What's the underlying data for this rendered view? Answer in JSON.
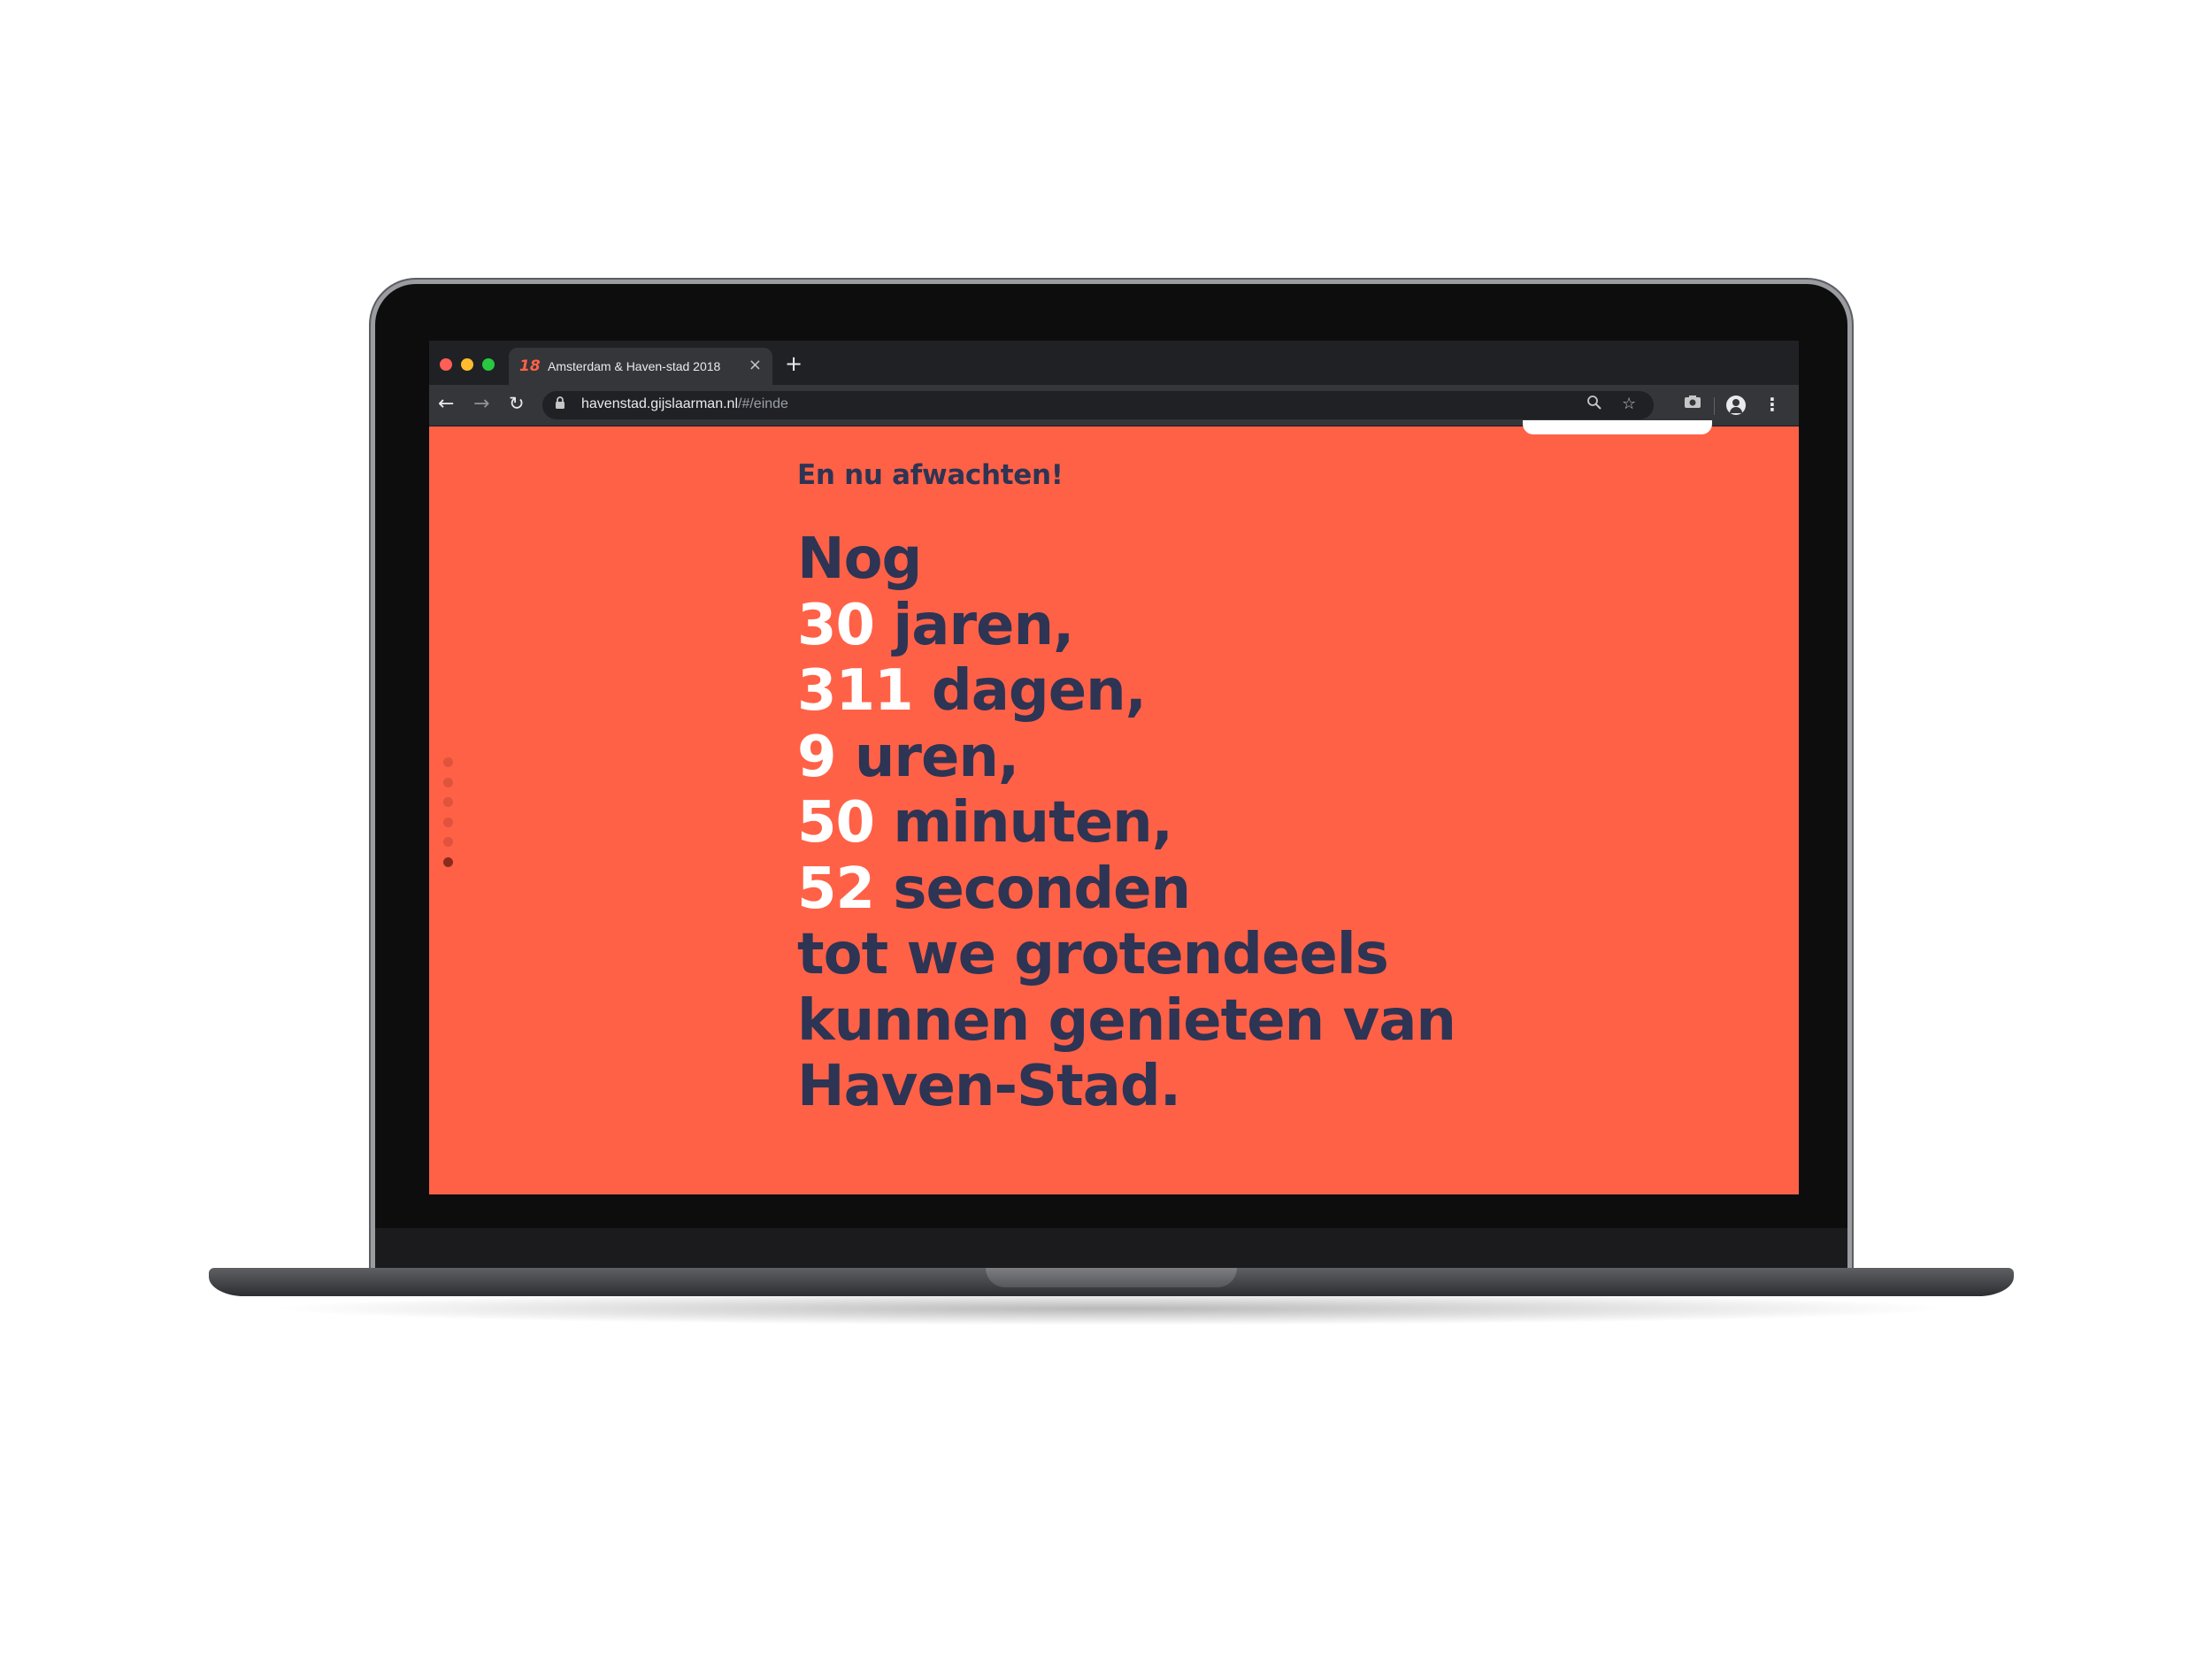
{
  "browser": {
    "tab": {
      "favicon": "18",
      "title": "Amsterdam & Haven-stad 2018",
      "close": "×"
    },
    "new_tab": "+",
    "nav": {
      "back": "←",
      "forward": "→",
      "reload": "↻"
    },
    "address": {
      "lock": "🔒",
      "host": "havenstad.gijslaarman.nl",
      "path": "/#/einde"
    },
    "icons": {
      "zoom": "⚲",
      "star": "☆",
      "camera": "📷",
      "menu": "⋮"
    }
  },
  "page": {
    "background_color": "#ff6147",
    "text_color": "#2e3453",
    "number_color": "#ffffff",
    "kicker": "En nu afwachten!",
    "intro": "Nog",
    "countdown": [
      {
        "value": "30",
        "unit": "jaren,"
      },
      {
        "value": "311",
        "unit": "dagen,"
      },
      {
        "value": "9",
        "unit": "uren,"
      },
      {
        "value": "50",
        "unit": "minuten,"
      },
      {
        "value": "52",
        "unit": "seconden"
      }
    ],
    "closing": [
      "tot we grotendeels",
      "kunnen genieten van",
      "Haven-Stad."
    ],
    "pager": {
      "total": 6,
      "active_index": 5
    }
  }
}
